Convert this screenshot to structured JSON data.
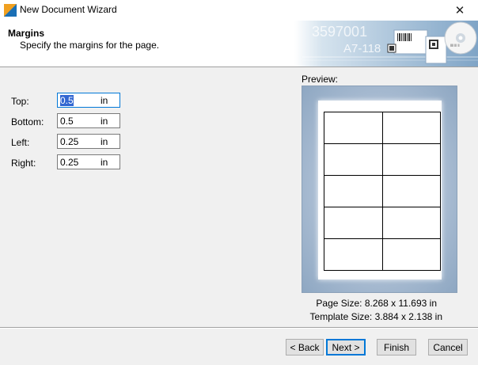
{
  "window": {
    "title": "New Document Wizard",
    "close_glyph": "✕"
  },
  "header": {
    "title": "Margins",
    "subtitle": "Specify the margins for the page.",
    "banner_text_1": "3597001",
    "banner_text_2": "A7-118"
  },
  "form": {
    "fields": [
      {
        "label": "Top:",
        "value": "0.5",
        "unit": "in"
      },
      {
        "label": "Bottom:",
        "value": "0.5",
        "unit": "in"
      },
      {
        "label": "Left:",
        "value": "0.25",
        "unit": "in"
      },
      {
        "label": "Right:",
        "value": "0.25",
        "unit": "in"
      }
    ]
  },
  "preview": {
    "label": "Preview:",
    "rows": 5,
    "columns": 2,
    "page_size_label": "Page Size:",
    "page_size_value": "8.268 x 11.693 in",
    "template_size_label": "Template Size:",
    "template_size_value": "3.884 x 2.138 in"
  },
  "buttons": {
    "back": "< Back",
    "next": "Next >",
    "finish": "Finish",
    "cancel": "Cancel"
  },
  "colors": {
    "accent": "#0078d7",
    "brand_orange": "#f0a020",
    "brand_blue": "#1a6fb5"
  }
}
